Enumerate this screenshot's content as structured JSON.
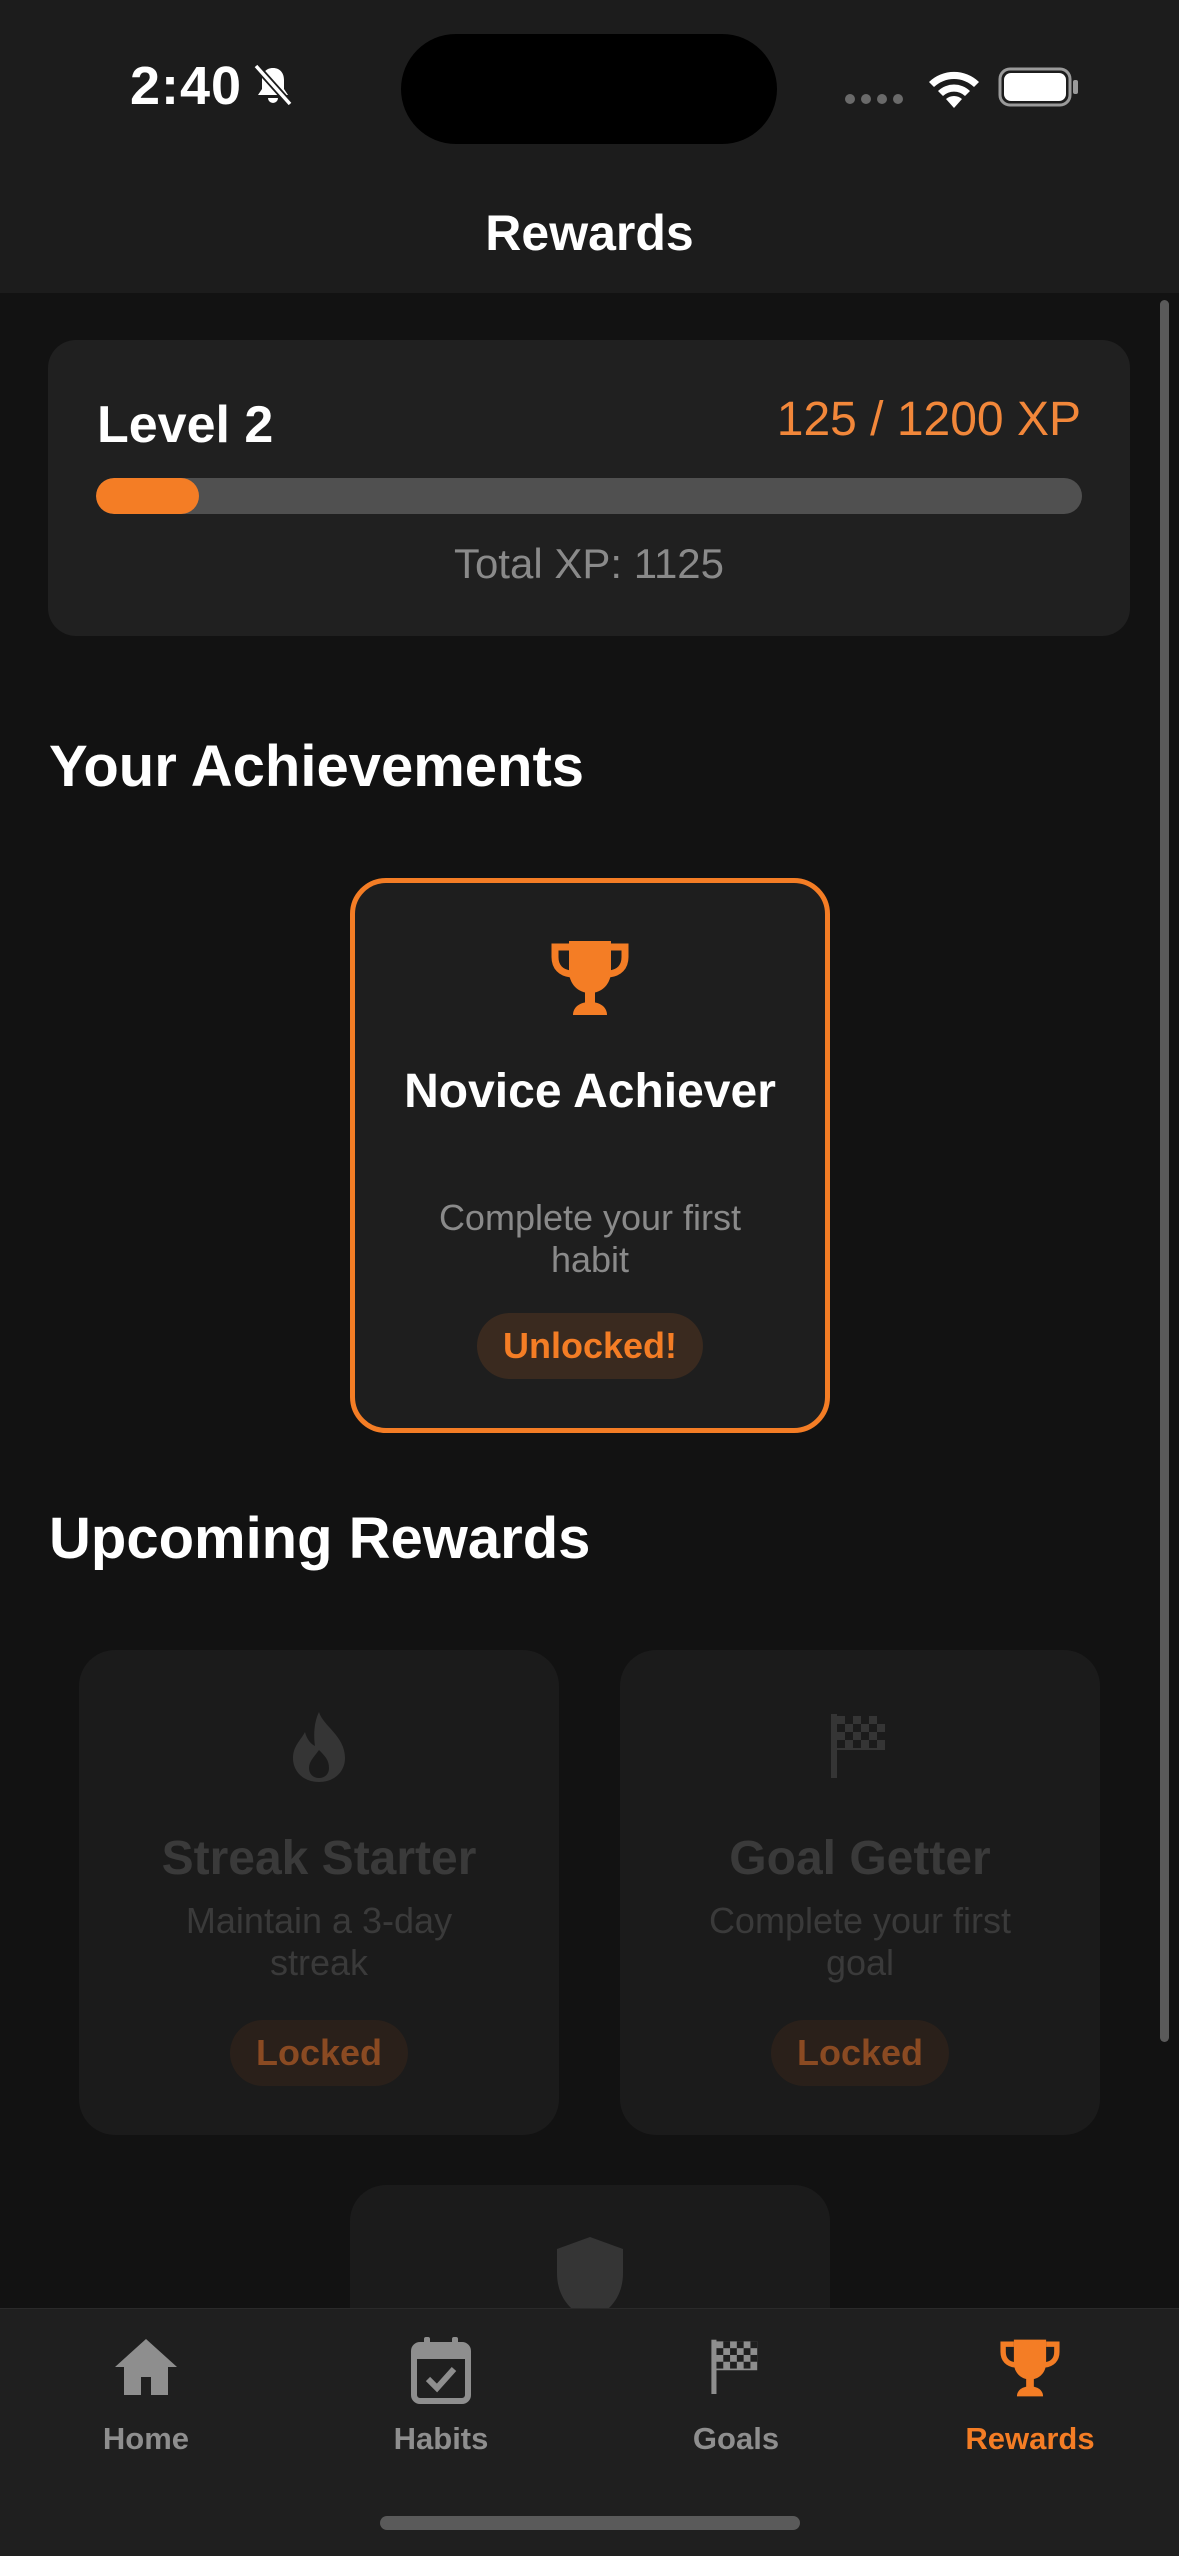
{
  "status_bar": {
    "time": "2:40"
  },
  "header": {
    "title": "Rewards"
  },
  "level": {
    "title": "Level 2",
    "xp_progress_text": "125 / 1200 XP",
    "progress_fraction": 0.104,
    "total_xp_text": "Total XP: 1125"
  },
  "sections": {
    "achievements_title": "Your Achievements",
    "upcoming_title": "Upcoming Rewards"
  },
  "achievements": [
    {
      "icon": "trophy-icon",
      "name": "Novice Achiever",
      "description": "Complete your first habit",
      "status": "Unlocked!"
    }
  ],
  "upcoming": [
    {
      "icon": "flame-icon",
      "name": "Streak Starter",
      "description": "Maintain a 3-day streak",
      "status": "Locked"
    },
    {
      "icon": "checkered-flag-icon",
      "name": "Goal Getter",
      "description": "Complete your first goal",
      "status": "Locked"
    },
    {
      "icon": "shield-icon"
    }
  ],
  "tabs": [
    {
      "label": "Home",
      "icon": "home-icon"
    },
    {
      "label": "Habits",
      "icon": "calendar-check-icon"
    },
    {
      "label": "Goals",
      "icon": "checkered-flag-icon"
    },
    {
      "label": "Rewards",
      "icon": "trophy-icon",
      "active": true
    }
  ],
  "colors": {
    "accent": "#f47d25",
    "background": "#121212",
    "card": "#202020"
  }
}
